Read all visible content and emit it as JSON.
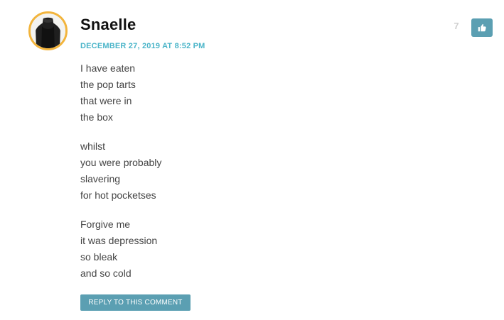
{
  "comment": {
    "author": "Snaelle",
    "date": "DECEMBER 27, 2019 AT 8:52 PM",
    "like_count": "7",
    "like_icon": "thumbs-up-icon",
    "avatar_icon": "dress-form-icon",
    "stanzas": [
      [
        "I have eaten",
        "the pop tarts",
        "that were in",
        "the box"
      ],
      [
        "whilst",
        "you were probably",
        "slavering",
        "for hot pocketses"
      ],
      [
        "Forgive me",
        "it was depression",
        "so bleak",
        "and so cold"
      ]
    ],
    "reply_label": "REPLY TO THIS COMMENT"
  },
  "colors": {
    "accent": "#5b9fb2",
    "date": "#4bb5c9",
    "avatar_border": "#f2b43c",
    "text": "#444444"
  }
}
